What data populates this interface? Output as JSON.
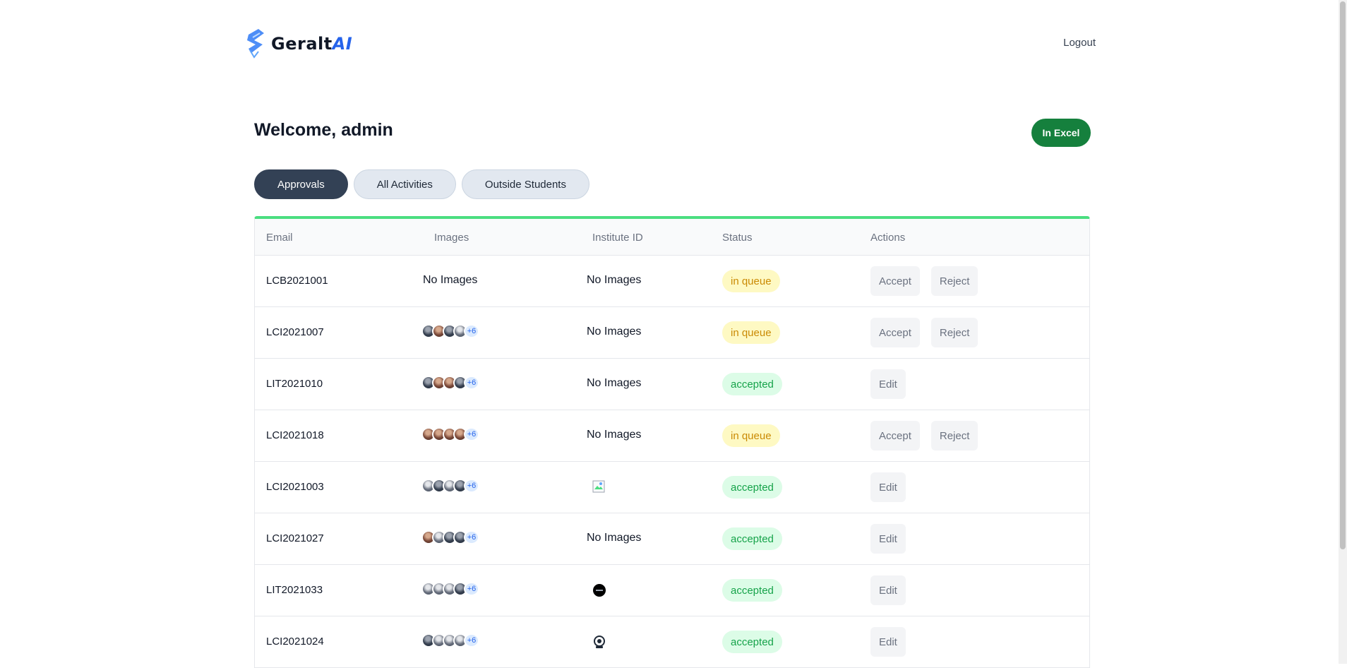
{
  "header": {
    "brand_main": "Geralt",
    "brand_accent": "AI",
    "logout_label": "Logout"
  },
  "welcome_text": "Welcome, admin",
  "excel_label": "In Excel",
  "tabs": [
    {
      "label": "Approvals",
      "active": true
    },
    {
      "label": "All Activities",
      "active": false
    },
    {
      "label": "Outside Students",
      "active": false
    }
  ],
  "table": {
    "columns": [
      "Email",
      "Images",
      "Institute ID",
      "Status",
      "Actions"
    ],
    "rows": [
      {
        "email": "LCB2021001",
        "images_text": "No Images",
        "images_more": "",
        "inst_text": "No Images",
        "inst_icon": "",
        "status": "in queue",
        "actions": [
          "Accept",
          "Reject"
        ]
      },
      {
        "email": "LCI2021007",
        "images_text": "",
        "images_more": "+6",
        "inst_text": "No Images",
        "inst_icon": "",
        "status": "in queue",
        "actions": [
          "Accept",
          "Reject"
        ]
      },
      {
        "email": "LIT2021010",
        "images_text": "",
        "images_more": "+6",
        "inst_text": "No Images",
        "inst_icon": "",
        "status": "accepted",
        "actions": [
          "Edit"
        ]
      },
      {
        "email": "LCI2021018",
        "images_text": "",
        "images_more": "+6",
        "inst_text": "No Images",
        "inst_icon": "",
        "status": "in queue",
        "actions": [
          "Accept",
          "Reject"
        ]
      },
      {
        "email": "LCI2021003",
        "images_text": "",
        "images_more": "+6",
        "inst_text": "",
        "inst_icon": "broken-image-icon",
        "status": "accepted",
        "actions": [
          "Edit"
        ]
      },
      {
        "email": "LCI2021027",
        "images_text": "",
        "images_more": "+6",
        "inst_text": "No Images",
        "inst_icon": "",
        "status": "accepted",
        "actions": [
          "Edit"
        ]
      },
      {
        "email": "LIT2021033",
        "images_text": "",
        "images_more": "+6",
        "inst_text": "",
        "inst_icon": "dark-circle-thumbnail-icon",
        "status": "accepted",
        "actions": [
          "Edit"
        ]
      },
      {
        "email": "LCI2021024",
        "images_text": "",
        "images_more": "+6",
        "inst_text": "",
        "inst_icon": "camera-thumbnail-icon",
        "status": "accepted",
        "actions": [
          "Edit"
        ]
      }
    ]
  },
  "colors": {
    "accent_green": "#15803d",
    "table_top_border": "#4ade80",
    "tab_active": "#334155",
    "brand_accent": "#2563eb"
  }
}
